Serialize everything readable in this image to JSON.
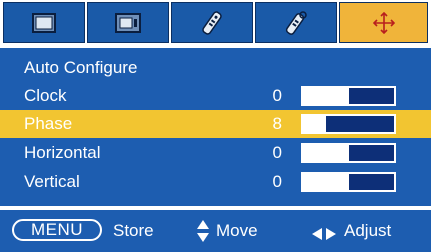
{
  "tabs": [
    {
      "icon": "picture-icon",
      "active": false
    },
    {
      "icon": "screen-icon",
      "active": false
    },
    {
      "icon": "remote-control-icon",
      "active": false
    },
    {
      "icon": "remote-settings-icon",
      "active": false
    },
    {
      "icon": "position-move-icon",
      "active": true
    }
  ],
  "menu": {
    "items": [
      {
        "label": "Auto Configure",
        "value": "",
        "level": null,
        "selected": false
      },
      {
        "label": "Clock",
        "value": "0",
        "level": 0.5,
        "selected": false
      },
      {
        "label": "Phase",
        "value": "8",
        "level": 0.25,
        "selected": true
      },
      {
        "label": "Horizontal",
        "value": "0",
        "level": 0.5,
        "selected": false
      },
      {
        "label": "Vertical",
        "value": "0",
        "level": 0.5,
        "selected": false
      }
    ]
  },
  "guide": {
    "menu_key": "MENU",
    "store": "Store",
    "move": "Move",
    "adjust": "Adjust"
  },
  "colors": {
    "panel": "#1d5db0",
    "tab": "#1a5aa8",
    "tab_active": "#f0b43a",
    "selected_row": "#f2c531",
    "bar_track": "#0d2f78"
  }
}
